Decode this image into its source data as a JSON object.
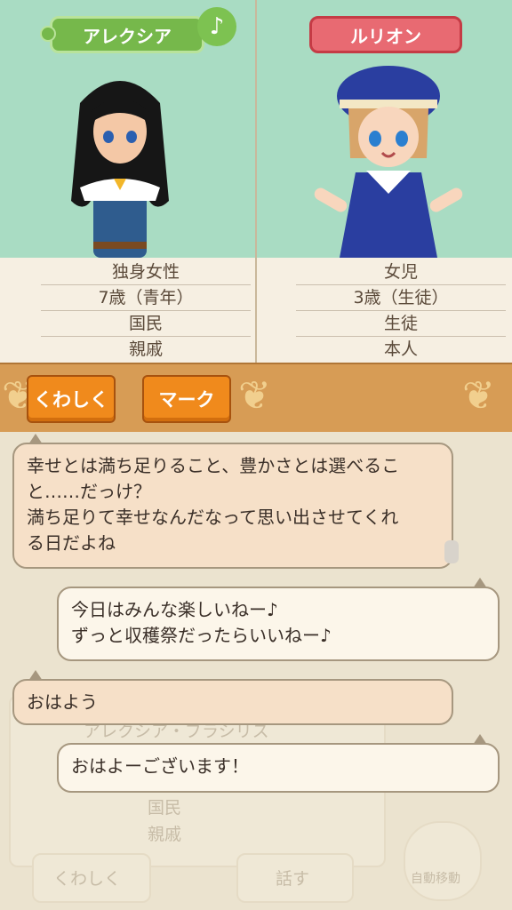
{
  "left_character": {
    "name": "アレクシア",
    "rows": [
      "独身女性",
      "7歳（青年）",
      "国民",
      "親戚"
    ],
    "hair_color": "#1a1a1a",
    "outfit_color": "#2f5c8e"
  },
  "right_character": {
    "name": "ルリオン",
    "rows": [
      "女児",
      "3歳（生徒）",
      "生徒",
      "本人"
    ],
    "hair_color": "#d8a56a",
    "outfit_color": "#2a3ea0"
  },
  "music_icon": "♪",
  "buttons": {
    "details": "くわしく",
    "mark": "マーク"
  },
  "background": {
    "name": "アレクシア・ブラシリス",
    "rows": [
      "国民",
      "親戚"
    ],
    "details_button": "くわしく",
    "talk_button": "話す",
    "auto_move": "自動移動"
  },
  "dialogue": [
    {
      "side": "left",
      "lines": [
        "幸せとは満ち足りること、豊かさとは選べるこ",
        "と……だっけ？",
        "満ち足りて幸せなんだなって思い出させてくれ",
        "る日だよね"
      ]
    },
    {
      "side": "right",
      "lines": [
        "今日はみんな楽しいねー♪",
        "ずっと収穫祭だったらいいねー♪"
      ]
    },
    {
      "side": "left",
      "lines": [
        "おはよう"
      ]
    },
    {
      "side": "right",
      "lines": [
        "おはよーございます！"
      ]
    }
  ]
}
